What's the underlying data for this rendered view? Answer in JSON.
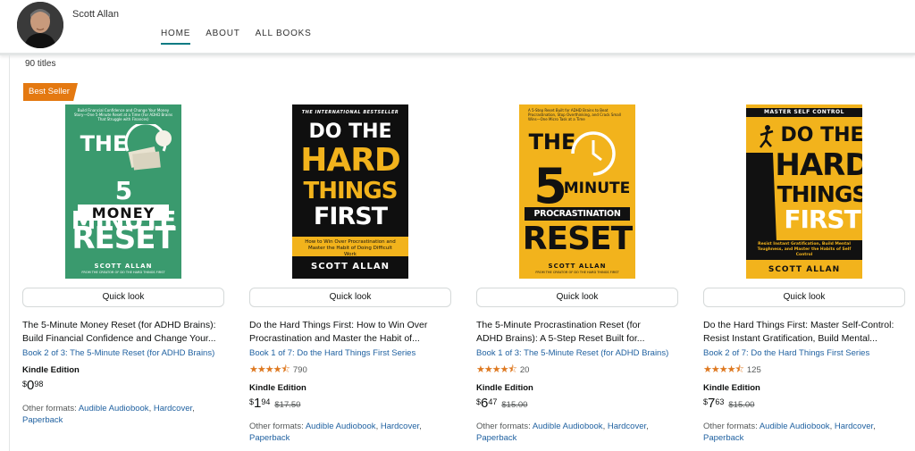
{
  "header": {
    "author_name": "Scott Allan",
    "nav": [
      "HOME",
      "ABOUT",
      "ALL BOOKS"
    ]
  },
  "titles_count": "90 titles",
  "badge": "Best Seller",
  "quick_look_label": "Quick look",
  "other_formats_prefix": "Other formats:",
  "colors": {
    "accent_teal": "#0a7b83",
    "link_blue": "#2162a1",
    "badge_orange": "#e47911",
    "star_orange": "#de7921"
  },
  "books": [
    {
      "cover": {
        "tagline": "Build Financial Confidence and Change Your Money Story—One 5-Minute Reset at a Time (For ADHD Brains That Struggle with Finances)",
        "line1": "THE",
        "line2": "5 MINUTE",
        "line3": "MONEY",
        "line4": "RESET",
        "author": "SCOTT ALLAN",
        "footer": "FROM THE CREATOR OF DO THE HARD THINGS FIRST"
      },
      "title_line1": "The 5-Minute Money Reset (for ADHD Brains):",
      "title_line2": "Build Financial Confidence and Change Your...",
      "series": "Book 2 of 3: The 5-Minute Reset (for ADHD Brains)",
      "rating": null,
      "edition": "Kindle Edition",
      "price": {
        "symbol": "$",
        "whole": "0",
        "fraction": "98"
      },
      "list_price": "",
      "other_formats": [
        "Audible Audiobook",
        "Hardcover",
        "Paperback"
      ]
    },
    {
      "cover": {
        "tagline": "THE INTERNATIONAL BESTSELLER",
        "line1": "DO THE",
        "line2": "HARD",
        "line3": "THINGS",
        "line4": "FIRST",
        "subtitle": "How to Win Over Procrastination and Master the Habit of Doing Difficult Work",
        "author": "SCOTT ALLAN"
      },
      "title_line1": "Do the Hard Things First: How to Win Over",
      "title_line2": "Procrastination and Master the Habit of...",
      "series": "Book 1 of 7: Do the Hard Things First Series",
      "rating": {
        "stars": 4.5,
        "count": "790"
      },
      "edition": "Kindle Edition",
      "price": {
        "symbol": "$",
        "whole": "1",
        "fraction": "94"
      },
      "list_price": "$17.50",
      "other_formats": [
        "Audible Audiobook",
        "Hardcover",
        "Paperback"
      ]
    },
    {
      "cover": {
        "tagline": "A 5-Step Reset Built for ADHD Brains to Beat Procrastination, Stop Overthinking, and Crack Small Wins—One Micro Task at a Time",
        "line1": "THE",
        "line2": "5 MINUTE",
        "line3": "PROCRASTINATION",
        "line4": "RESET",
        "author": "SCOTT ALLAN",
        "footer": "FROM THE CREATOR OF DO THE HARD THINGS FIRST"
      },
      "title_line1": "The 5-Minute Procrastination Reset (for",
      "title_line2": "ADHD Brains): A 5-Step Reset Built for...",
      "series": "Book 1 of 3: The 5-Minute Reset (for ADHD Brains)",
      "rating": {
        "stars": 4.5,
        "count": "20"
      },
      "edition": "Kindle Edition",
      "price": {
        "symbol": "$",
        "whole": "6",
        "fraction": "47"
      },
      "list_price": "$15.00",
      "other_formats": [
        "Audible Audiobook",
        "Hardcover",
        "Paperback"
      ]
    },
    {
      "cover": {
        "tagline": "MASTER SELF CONTROL",
        "line1": "DO THE",
        "line2": "HARD",
        "line3": "THINGS",
        "line4": "FIRST",
        "subtitle": "Resist Instant Gratification, Build Mental Toughness, and Master the Habits of Self Control",
        "author": "SCOTT ALLAN"
      },
      "title_line1": "Do the Hard Things First: Master Self-Control:",
      "title_line2": "Resist Instant Gratification, Build Mental...",
      "series": "Book 2 of 7: Do the Hard Things First Series",
      "rating": {
        "stars": 4.5,
        "count": "125"
      },
      "edition": "Kindle Edition",
      "price": {
        "symbol": "$",
        "whole": "7",
        "fraction": "63"
      },
      "list_price": "$15.00",
      "other_formats": [
        "Audible Audiobook",
        "Hardcover",
        "Paperback"
      ]
    }
  ]
}
